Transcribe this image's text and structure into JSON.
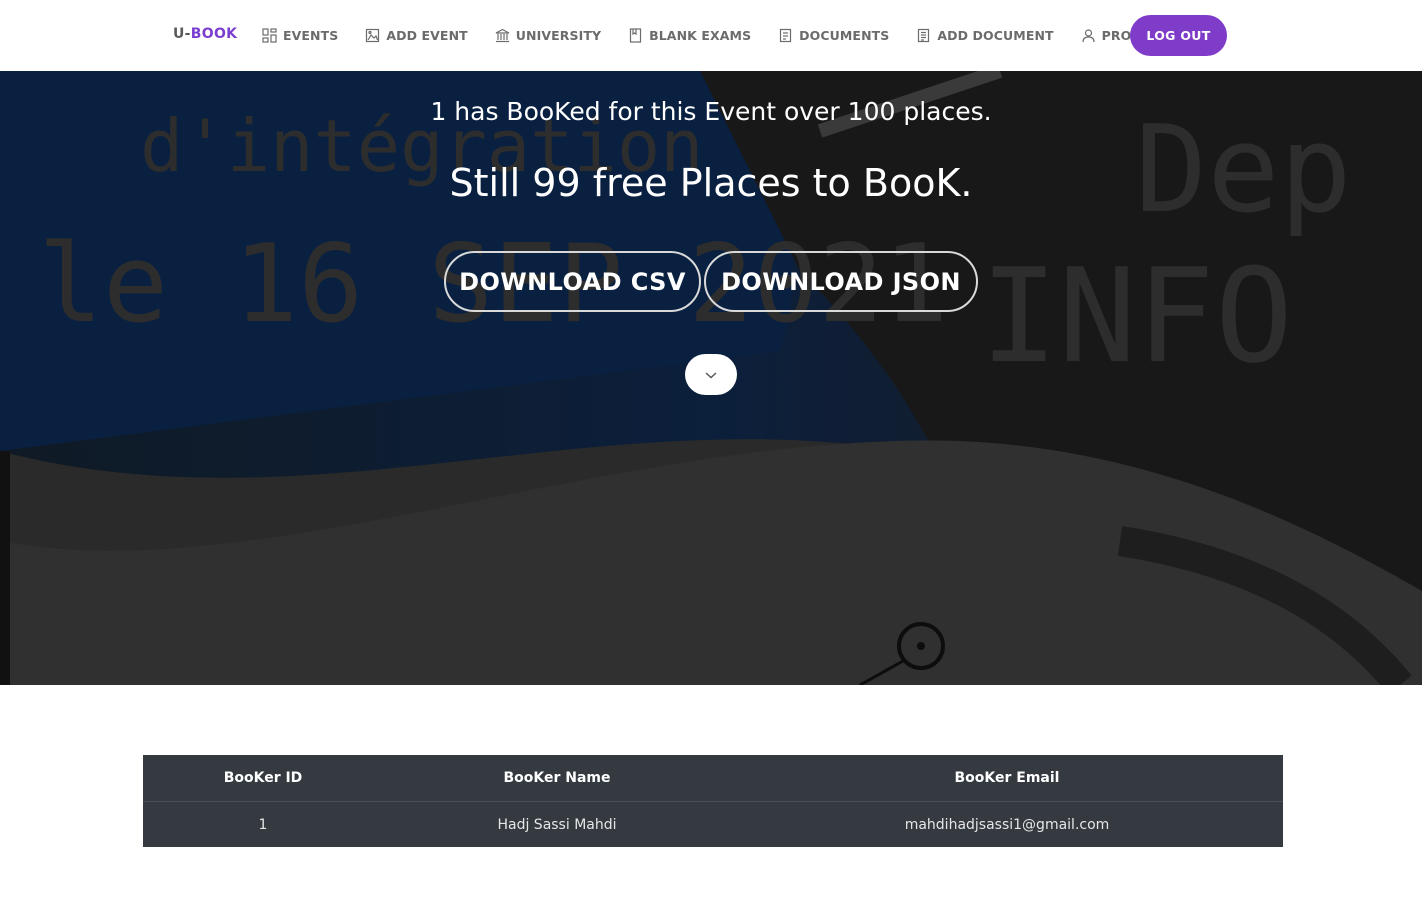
{
  "brand": {
    "prefix": "U-",
    "name": "BOOK"
  },
  "nav": {
    "items": [
      {
        "label": "EVENTS",
        "icon": "grid-icon"
      },
      {
        "label": "ADD EVENT",
        "icon": "image-icon"
      },
      {
        "label": "UNIVERSITY",
        "icon": "bank-icon"
      },
      {
        "label": "BLANK EXAMS",
        "icon": "book-icon"
      },
      {
        "label": "DOCUMENTS",
        "icon": "document-icon"
      },
      {
        "label": "ADD DOCUMENT",
        "icon": "document-add-icon"
      },
      {
        "label": "PROFILE",
        "icon": "user-icon"
      }
    ],
    "logout_label": "LOG OUT"
  },
  "hero": {
    "booked_text": "1 has BooKed for this Event over 100 places.",
    "free_text": "Still 99 free Places to BooK.",
    "download_csv_label": "DOWNLOAD CSV",
    "download_json_label": "DOWNLOAD JSON",
    "scroll_icon": "chevron-down-icon",
    "background_text": {
      "line1": "d'intégration",
      "line2": "le 16 SEP 2021",
      "dep": "Dep",
      "info": "INFO"
    }
  },
  "table": {
    "headers": [
      "BooKer ID",
      "BooKer Name",
      "BooKer Email"
    ],
    "rows": [
      [
        "1",
        "Hadj Sassi Mahdi",
        "mahdihadjsassi1@gmail.com"
      ]
    ]
  },
  "colors": {
    "accent": "#7f3cc8",
    "table_bg": "#343a40"
  }
}
